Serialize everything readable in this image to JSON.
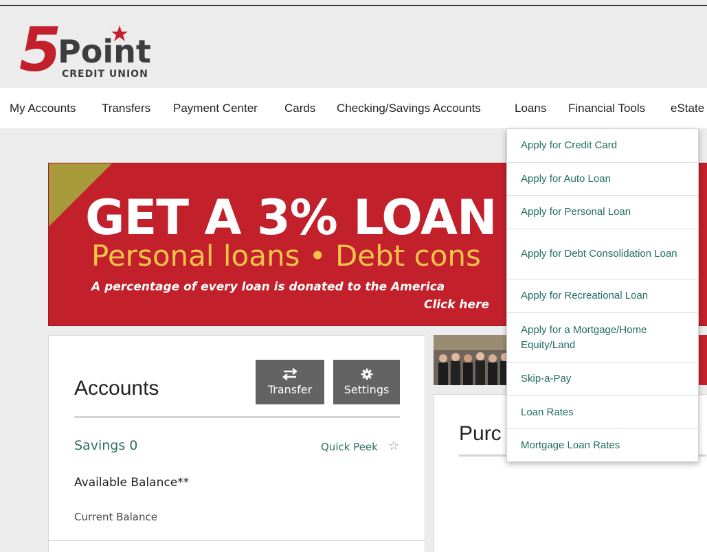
{
  "brand": {
    "logo_numeral": "5",
    "logo_word": "Point",
    "logo_tagline": "CREDIT UNION"
  },
  "nav": {
    "items": [
      "My Accounts",
      "Transfers",
      "Payment Center",
      "Cards",
      "Checking/Savings Accounts",
      "Loans",
      "Financial Tools",
      "eState"
    ]
  },
  "loans_menu": {
    "items": [
      "Apply for Credit Card",
      "Apply for Auto Loan",
      "Apply for Personal Loan",
      "Apply for Debt Consolidation Loan",
      "Apply for Recreational Loan",
      "Apply for a Mortgage/Home Equity/Land",
      "Skip-a-Pay",
      "Loan Rates",
      "Mortgage Loan Rates"
    ]
  },
  "banner": {
    "headline": "GET A 3% LOAN",
    "subhead": "Personal loans • Debt cons",
    "note": "A percentage of every loan is donated to the America",
    "cta": "Click here"
  },
  "accounts": {
    "title": "Accounts",
    "transfer_label": "Transfer",
    "settings_label": "Settings",
    "account_name": "Savings 0",
    "quick_peek": "Quick Peek",
    "available_balance": "Available Balance**",
    "current_balance": "Current Balance"
  },
  "purchase": {
    "title": "Purc"
  },
  "colors": {
    "brand_red": "#c2202b",
    "link_green": "#1f6e5e",
    "banner_yellow": "#f4c34a",
    "button_gray": "#636363"
  }
}
